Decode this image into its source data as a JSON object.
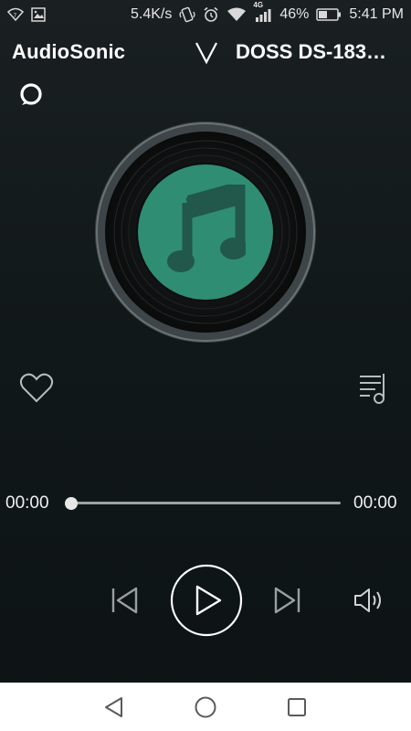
{
  "status_bar": {
    "network_speed": "5.4K/s",
    "signal_tag": "4G",
    "battery_percent": "46%",
    "time": "5:41 PM",
    "icons": [
      "wifi-question-icon",
      "image-icon",
      "vibrate-icon",
      "alarm-icon",
      "wifi-icon",
      "cell-signal-icon",
      "battery-icon"
    ]
  },
  "header": {
    "app_title": "AudioSonic",
    "device_name": "DOSS DS-183…",
    "device_chevron_icon": "chevron-down-icon",
    "assistant_icon": "alexa-ring-icon"
  },
  "player": {
    "album_art_icon": "music-note-icon",
    "favorite_icon": "heart-icon",
    "queue_icon": "playlist-icon",
    "elapsed": "00:00",
    "duration": "00:00",
    "progress_fraction": 0,
    "controls": {
      "previous_icon": "skip-previous-icon",
      "play_icon": "play-icon",
      "next_icon": "skip-next-icon",
      "volume_icon": "volume-icon"
    }
  },
  "nav_bar": {
    "back_icon": "back-triangle-icon",
    "home_icon": "home-circle-icon",
    "recents_icon": "recents-square-icon"
  },
  "colors": {
    "accent_teal": "#2f8d74",
    "disc_dark": "#0f1112",
    "disc_rim": "#5b6366",
    "background": "#121a1b"
  }
}
